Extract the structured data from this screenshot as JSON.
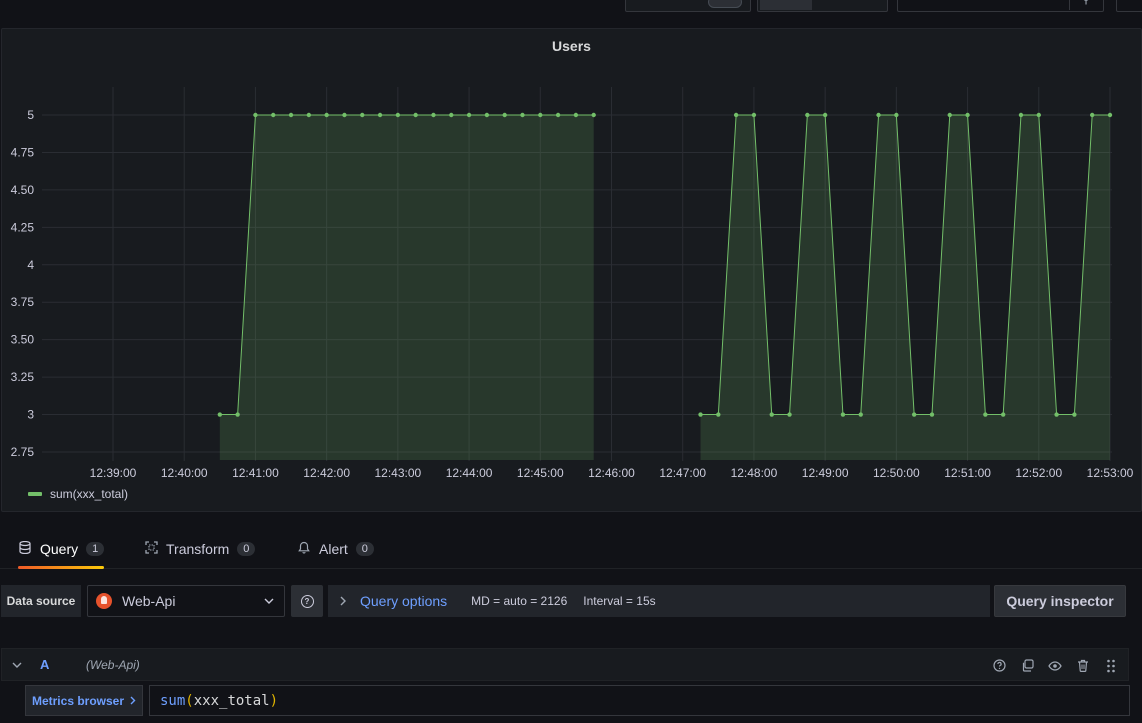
{
  "panel": {
    "title": "Users",
    "legend": "sum(xxx_total)"
  },
  "chart_data": {
    "type": "area",
    "title": "Users",
    "xlabel": "",
    "ylabel": "",
    "ylim": [
      2.75,
      5
    ],
    "y_ticks": [
      "2.75",
      "3",
      "3.25",
      "3.50",
      "3.75",
      "4",
      "4.25",
      "4.50",
      "4.75",
      "5"
    ],
    "x_ticks": [
      "12:39:00",
      "12:40:00",
      "12:41:00",
      "12:42:00",
      "12:43:00",
      "12:44:00",
      "12:45:00",
      "12:46:00",
      "12:47:00",
      "12:48:00",
      "12:49:00",
      "12:50:00",
      "12:51:00",
      "12:52:00",
      "12:53:00"
    ],
    "grid": true,
    "legend_position": "bottom-left",
    "color": "#73bf69",
    "series": [
      {
        "name": "sum(xxx_total)",
        "segments": [
          {
            "x": [
              "12:40:30",
              "12:40:45",
              "12:41:00",
              "12:41:15",
              "12:41:30",
              "12:41:45",
              "12:42:00",
              "12:42:15",
              "12:42:30",
              "12:42:45",
              "12:43:00",
              "12:43:15",
              "12:43:30",
              "12:43:45",
              "12:44:00",
              "12:44:15",
              "12:44:30",
              "12:44:45",
              "12:45:00",
              "12:45:15",
              "12:45:30",
              "12:45:45"
            ],
            "y": [
              3,
              3,
              5,
              5,
              5,
              5,
              5,
              5,
              5,
              5,
              5,
              5,
              5,
              5,
              5,
              5,
              5,
              5,
              5,
              5,
              5,
              5
            ]
          },
          {
            "x": [
              "12:47:15",
              "12:47:30",
              "12:47:45",
              "12:48:00",
              "12:48:15",
              "12:48:30",
              "12:48:45",
              "12:49:00",
              "12:49:15",
              "12:49:30",
              "12:49:45",
              "12:50:00",
              "12:50:15",
              "12:50:30",
              "12:50:45",
              "12:51:00",
              "12:51:15",
              "12:51:30",
              "12:51:45",
              "12:52:00",
              "12:52:15",
              "12:52:30",
              "12:52:45",
              "12:53:00"
            ],
            "y": [
              3,
              3,
              5,
              5,
              3,
              3,
              5,
              5,
              3,
              3,
              5,
              5,
              3,
              3,
              5,
              5,
              3,
              3,
              5,
              5,
              3,
              3,
              5,
              5
            ]
          }
        ]
      }
    ]
  },
  "tabs": [
    {
      "label": "Query",
      "count": "1",
      "icon": "database-icon"
    },
    {
      "label": "Transform",
      "count": "0",
      "icon": "transform-icon"
    },
    {
      "label": "Alert",
      "count": "0",
      "icon": "bell-icon"
    }
  ],
  "datasource": {
    "label": "Data source",
    "name": "Web-Api",
    "icon": "prometheus-logo"
  },
  "query_options": {
    "title": "Query options",
    "max_data_points": "MD = auto = 2126",
    "interval": "Interval = 15s"
  },
  "inspector": "Query inspector",
  "query": {
    "ref_id": "A",
    "datasource": "(Web-Api)",
    "metrics_browser": "Metrics browser",
    "expr_fn": "sum",
    "expr_open": "(",
    "expr_arg": "xxx_total",
    "expr_close": ")"
  },
  "colors": {
    "series": "#73bf69",
    "link": "#6e9fff",
    "accent_start": "#f05a28",
    "accent_end": "#fbca0a"
  }
}
